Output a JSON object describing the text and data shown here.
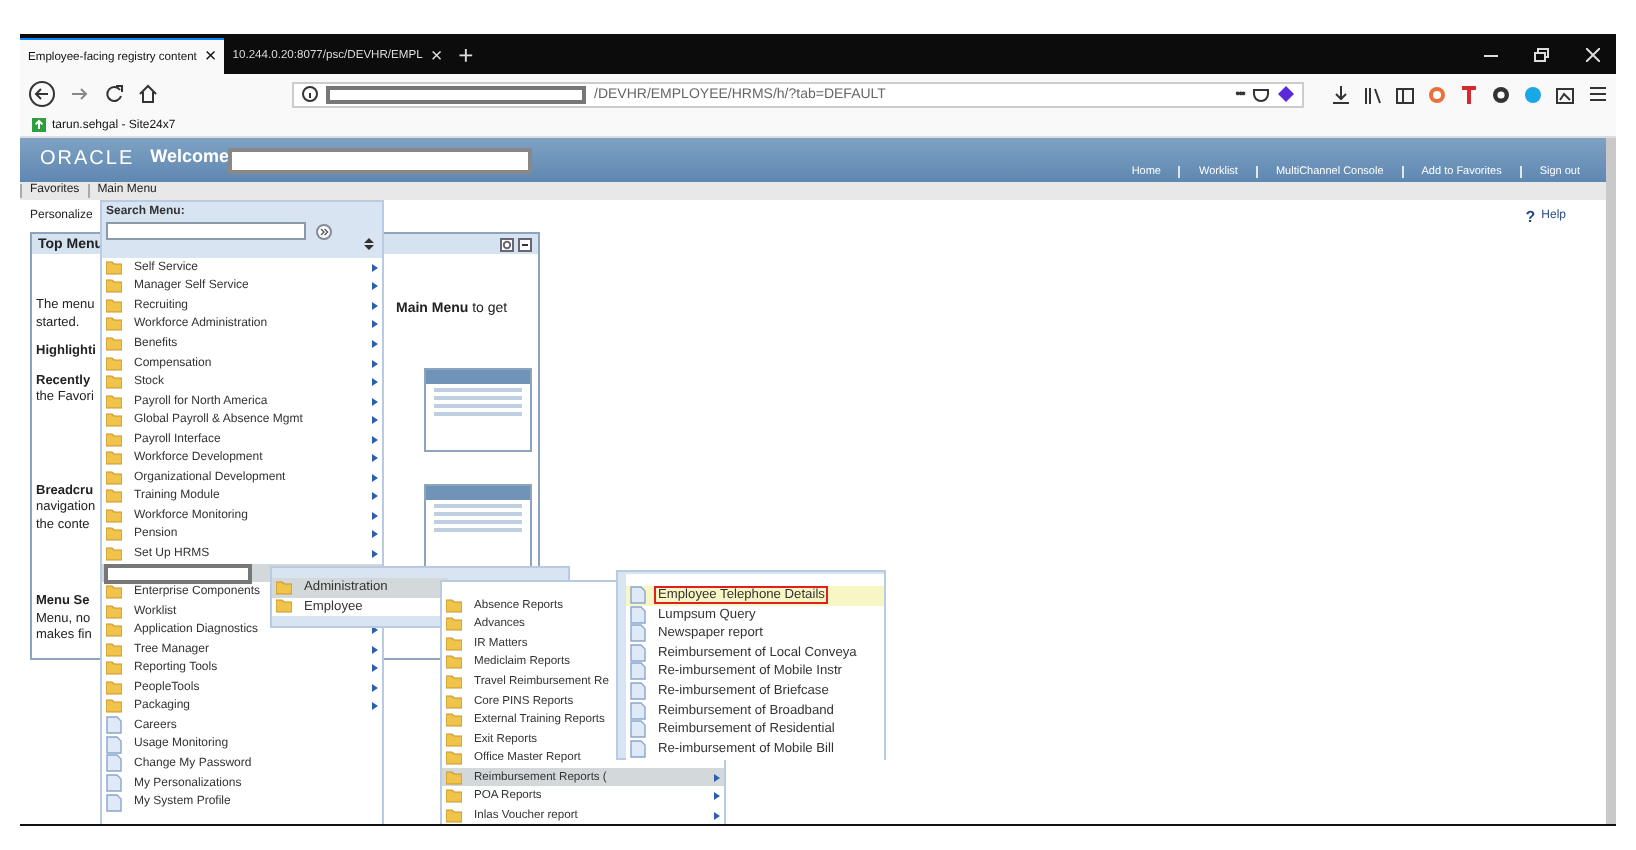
{
  "browser": {
    "tabs": [
      {
        "title": "Employee-facing registry content",
        "close": "×",
        "selected": true
      },
      {
        "title": "10.244.0.20:8077/psc/DEVHR/EMPL",
        "close": "×",
        "selected": false
      }
    ],
    "new_tab": "+",
    "url_path": "/DEVHR/EMPLOYEE/HRMS/h/?tab=DEFAULT",
    "url_more": "•••",
    "bookmarks": [
      "tarun.sehgal - Site24x7"
    ]
  },
  "header": {
    "logo": "ORACLE",
    "welcome": "Welcome",
    "links": [
      "Home",
      "Worklist",
      "MultiChannel Console",
      "Add to Favorites",
      "Sign out"
    ]
  },
  "menu_bar": [
    "Favorites",
    "Main Menu"
  ],
  "personalize": "Personalize",
  "help": {
    "icon": "?",
    "label": "Help"
  },
  "top_menu": {
    "title": "Top Menu",
    "sections": [
      {
        "lines": [
          "The menu",
          "started."
        ]
      },
      {
        "heading": "Highlighti"
      },
      {
        "heading": "Recently",
        "lines": [
          "the Favori"
        ]
      },
      {
        "heading": "Breadcru",
        "lines": [
          "navigation",
          "the conte"
        ]
      },
      {
        "heading": "Menu Se",
        "lines": [
          "Menu, no",
          "makes fin"
        ]
      }
    ],
    "intro_tail": "**Main Menu** to get"
  },
  "main_menu": {
    "search_label": "Search Menu:",
    "items": [
      {
        "kind": "folder",
        "label": "Self Service",
        "selected": false
      },
      {
        "kind": "folder",
        "label": "Manager Self Service",
        "selected": false
      },
      {
        "kind": "folder",
        "label": "Recruiting",
        "selected": false
      },
      {
        "kind": "folder",
        "label": "Workforce Administration",
        "selected": false
      },
      {
        "kind": "folder",
        "label": "Benefits",
        "selected": false
      },
      {
        "kind": "folder",
        "label": "Compensation",
        "selected": false
      },
      {
        "kind": "folder",
        "label": "Stock",
        "selected": false
      },
      {
        "kind": "folder",
        "label": "Payroll for North America",
        "selected": false
      },
      {
        "kind": "folder",
        "label": "Global Payroll & Absence Mgmt",
        "selected": false
      },
      {
        "kind": "folder",
        "label": "Payroll Interface",
        "selected": false
      },
      {
        "kind": "folder",
        "label": "Workforce Development",
        "selected": false
      },
      {
        "kind": "folder",
        "label": "Organizational Development",
        "selected": false
      },
      {
        "kind": "folder",
        "label": "Training Module",
        "selected": false
      },
      {
        "kind": "folder",
        "label": "Workforce Monitoring",
        "selected": false
      },
      {
        "kind": "folder",
        "label": "Pension",
        "selected": false
      },
      {
        "kind": "folder",
        "label": "Set Up HRMS",
        "selected": false
      },
      {
        "kind": "redacted",
        "selected": true
      },
      {
        "kind": "folder",
        "label": "Enterprise Components",
        "selected": false
      },
      {
        "kind": "folder",
        "label": "Worklist",
        "selected": false
      },
      {
        "kind": "folder",
        "label": "Application Diagnostics",
        "selected": false
      },
      {
        "kind": "folder",
        "label": "Tree Manager",
        "selected": false
      },
      {
        "kind": "folder",
        "label": "Reporting Tools",
        "selected": false
      },
      {
        "kind": "folder",
        "label": "PeopleTools",
        "selected": false
      },
      {
        "kind": "folder",
        "label": "Packaging",
        "selected": false
      },
      {
        "kind": "document",
        "label": "Careers",
        "selected": false
      },
      {
        "kind": "document",
        "label": "Usage Monitoring",
        "selected": false
      },
      {
        "kind": "document",
        "label": "Change My Password",
        "selected": false
      },
      {
        "kind": "document",
        "label": "My Personalizations",
        "selected": false
      },
      {
        "kind": "document",
        "label": "My System Profile",
        "selected": false
      }
    ]
  },
  "submenu_1": {
    "items": [
      {
        "kind": "folder",
        "label": "Administration",
        "selected": true
      },
      {
        "kind": "folder",
        "label": "Employee",
        "selected": false
      }
    ]
  },
  "submenu_2": {
    "items": [
      {
        "kind": "folder",
        "label": "Absence Reports",
        "selected": false
      },
      {
        "kind": "folder",
        "label": "Advances",
        "selected": false
      },
      {
        "kind": "folder",
        "label": "IR Matters",
        "selected": false
      },
      {
        "kind": "folder",
        "label": "Mediclaim Reports",
        "selected": false
      },
      {
        "kind": "folder",
        "label": "Travel Reimbursement Re",
        "selected": false
      },
      {
        "kind": "folder",
        "label": "Core PINS Reports",
        "selected": false
      },
      {
        "kind": "folder",
        "label": "External Training Reports",
        "selected": false
      },
      {
        "kind": "folder",
        "label": "Exit Reports",
        "selected": false
      },
      {
        "kind": "folder",
        "label": "Office Master Report",
        "selected": false
      },
      {
        "kind": "folder",
        "label": "Reimbursement Reports (",
        "selected": true
      },
      {
        "kind": "folder",
        "label": "POA Reports",
        "selected": false
      },
      {
        "kind": "folder",
        "label": "Inlas Voucher report",
        "selected": false
      }
    ]
  },
  "submenu_3": {
    "items": [
      {
        "kind": "document",
        "label": "Employee Telephone Details",
        "selected": true,
        "annotated": true
      },
      {
        "kind": "document",
        "label": "Lumpsum Query",
        "selected": false,
        "annotated": false
      },
      {
        "kind": "document",
        "label": "Newspaper report",
        "selected": false,
        "annotated": false
      },
      {
        "kind": "document",
        "label": "Reimbursement of Local Conveya",
        "selected": false,
        "annotated": false
      },
      {
        "kind": "document",
        "label": "Re-imbursement of Mobile Instr",
        "selected": false,
        "annotated": false
      },
      {
        "kind": "document",
        "label": "Re-imbursement of Briefcase",
        "selected": false,
        "annotated": false
      },
      {
        "kind": "document",
        "label": "Reimbursement of Broadband",
        "selected": false,
        "annotated": false
      },
      {
        "kind": "document",
        "label": "Reimbursement of Residential",
        "selected": false,
        "annotated": false
      },
      {
        "kind": "document",
        "label": "Re-imbursement of Mobile Bill",
        "selected": false,
        "annotated": false
      }
    ]
  }
}
